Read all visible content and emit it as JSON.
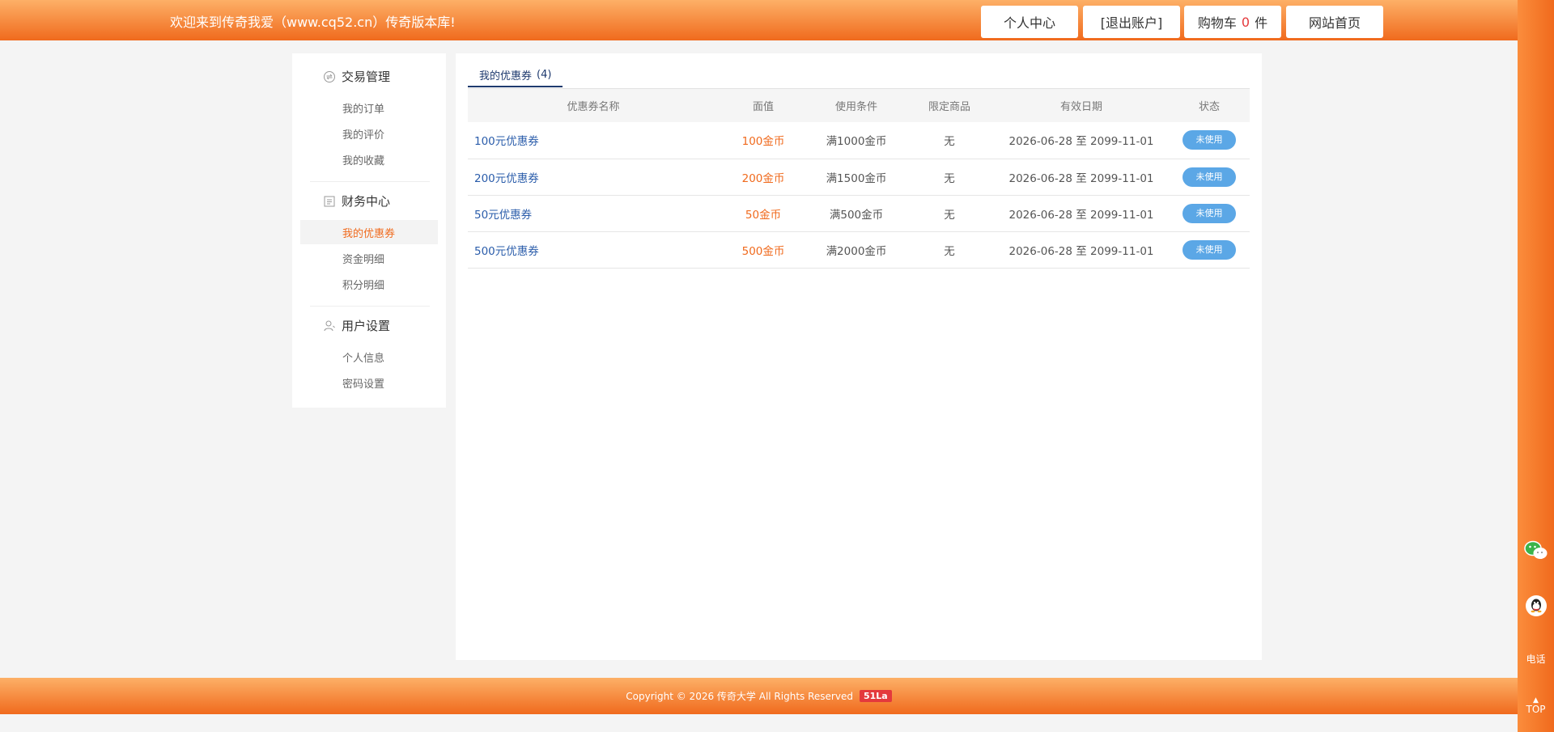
{
  "header": {
    "welcome": "欢迎来到传奇我爱（www.cq52.cn）传奇版本库!",
    "personal_center": "个人中心",
    "logout": "[退出账户]",
    "cart_label": "购物车",
    "cart_count": "0",
    "cart_unit": "件",
    "home": "网站首页"
  },
  "menu": {
    "groups": [
      {
        "label": "交易管理",
        "icon": "exchange-icon",
        "items": [
          "我的订单",
          "我的评价",
          "我的收藏"
        ]
      },
      {
        "label": "财务中心",
        "icon": "finance-icon",
        "items": [
          "我的优惠券",
          "资金明细",
          "积分明细"
        ]
      },
      {
        "label": "用户设置",
        "icon": "user-icon",
        "items": [
          "个人信息",
          "密码设置"
        ]
      }
    ],
    "active_item": "我的优惠券"
  },
  "tab": {
    "label": "我的优惠券",
    "count": "(4)"
  },
  "table": {
    "headers": [
      "优惠券名称",
      "面值",
      "使用条件",
      "限定商品",
      "有效日期",
      "状态"
    ],
    "rows": [
      {
        "name": "100元优惠券",
        "face": "100金币",
        "condition": "满1000金币",
        "limit": "无",
        "date": "2026-06-28 至 2099-11-01",
        "status": "未使用"
      },
      {
        "name": "200元优惠券",
        "face": "200金币",
        "condition": "满1500金币",
        "limit": "无",
        "date": "2026-06-28 至 2099-11-01",
        "status": "未使用"
      },
      {
        "name": "50元优惠券",
        "face": "50金币",
        "condition": "满500金币",
        "limit": "无",
        "date": "2026-06-28 至 2099-11-01",
        "status": "未使用"
      },
      {
        "name": "500元优惠券",
        "face": "500金币",
        "condition": "满2000金币",
        "limit": "无",
        "date": "2026-06-28 至 2099-11-01",
        "status": "未使用"
      }
    ]
  },
  "right_bar": {
    "wechat_icon": "wechat-icon",
    "qq_icon": "qq-icon",
    "phone": "电话",
    "top": "TOP"
  },
  "footer": {
    "copyright": "Copyright © 2026 传奇大学 All Rights Reserved",
    "badge": "51La"
  },
  "colors": {
    "brand_orange": "#f06a1d",
    "link_blue": "#2a5caa",
    "status_blue": "#5ba7e6"
  }
}
